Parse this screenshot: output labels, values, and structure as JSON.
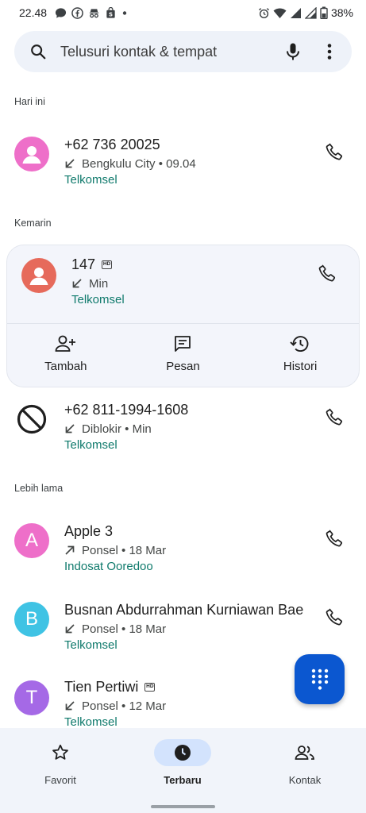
{
  "status_bar": {
    "time": "22.48",
    "battery": "38%"
  },
  "search": {
    "placeholder": "Telusuri kontak & tempat"
  },
  "sections": {
    "today": "Hari ini",
    "yesterday": "Kemarin",
    "older": "Lebih lama"
  },
  "calls": [
    {
      "name": "+62 736 20025",
      "detail": "Bengkulu City • 09.04",
      "direction": "incoming",
      "carrier": "Telkomsel",
      "avatar_color": "#ee6fc9",
      "avatar_type": "person",
      "hd": false
    },
    {
      "name": "147",
      "detail": "Min",
      "direction": "incoming",
      "carrier": "Telkomsel",
      "avatar_color": "#e66a5b",
      "avatar_type": "person",
      "hd": true
    },
    {
      "name": "+62 811-1994-1608",
      "detail": "Diblokir • Min",
      "direction": "incoming",
      "carrier": "Telkomsel",
      "avatar_type": "blocked",
      "hd": false
    },
    {
      "name": "Apple 3",
      "detail": "Ponsel • 18 Mar",
      "direction": "outgoing",
      "carrier": "Indosat Ooredoo",
      "avatar_color": "#ee6fc9",
      "avatar_letter": "A",
      "hd": false
    },
    {
      "name": "Busnan Abdurrahman Kurniawan Bae",
      "detail": "Ponsel • 18 Mar",
      "direction": "incoming",
      "carrier": "Telkomsel",
      "avatar_color": "#3fc3e4",
      "avatar_letter": "B",
      "hd": false
    },
    {
      "name": "Tien Pertiwi",
      "detail": "Ponsel • 12 Mar",
      "direction": "incoming",
      "carrier": "Telkomsel",
      "avatar_color": "#a569e6",
      "avatar_letter": "T",
      "hd": true
    }
  ],
  "card_actions": {
    "add": "Tambah",
    "message": "Pesan",
    "history": "Histori"
  },
  "nav": {
    "favorites": "Favorit",
    "recents": "Terbaru",
    "contacts": "Kontak"
  },
  "colors": {
    "accent": "#0b57d0",
    "carrier": "#0f7a6c",
    "nav_active": "#d3e3fd"
  }
}
